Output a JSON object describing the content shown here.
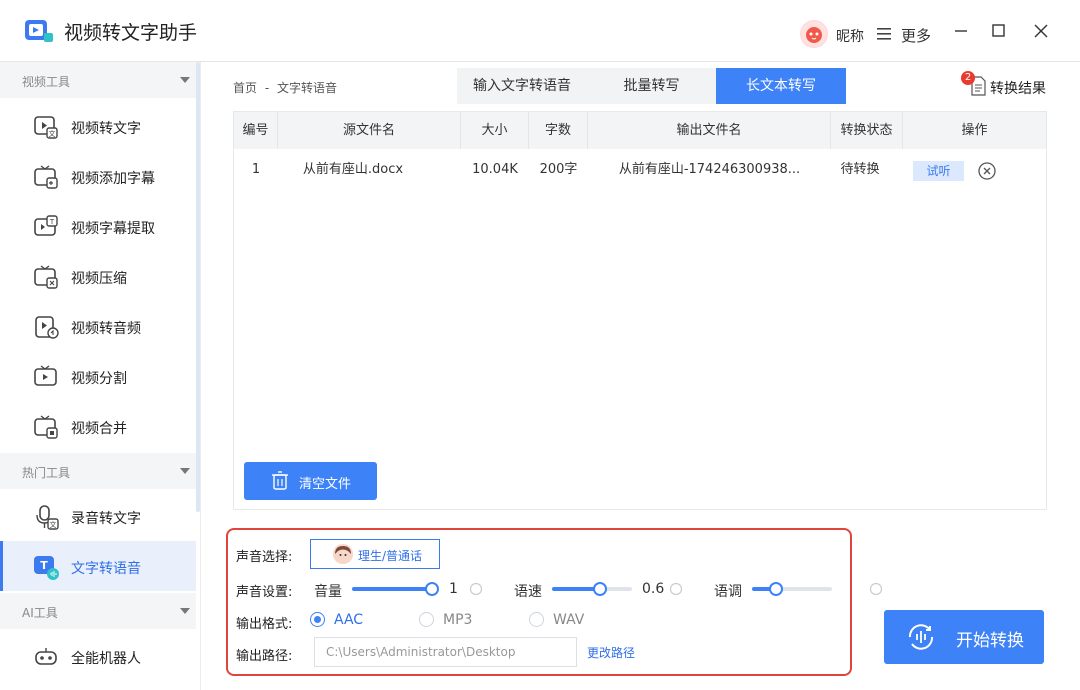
{
  "app": {
    "title": "视频转文字助手"
  },
  "topbar": {
    "nickname": "昵称",
    "more": "更多"
  },
  "sidebar": {
    "groups": [
      {
        "label": "视频工具",
        "items": [
          "视频转文字",
          "视频添加字幕",
          "视频字幕提取",
          "视频压缩",
          "视频转音频",
          "视频分割",
          "视频合并"
        ]
      },
      {
        "label": "热门工具",
        "items": [
          "录音转文字",
          "文字转语音"
        ]
      },
      {
        "label": "AI工具",
        "items": [
          "全能机器人"
        ]
      }
    ],
    "active_item": "文字转语音"
  },
  "breadcrumb": {
    "home": "首页",
    "sep": "-",
    "current": "文字转语音"
  },
  "tabs": [
    "输入文字转语音",
    "批量转写",
    "长文本转写"
  ],
  "active_tab": "长文本转写",
  "result": {
    "label": "转换结果",
    "badge": "2"
  },
  "table": {
    "headers": [
      "编号",
      "源文件名",
      "大小",
      "字数",
      "输出文件名",
      "转换状态",
      "操作"
    ],
    "rows": [
      {
        "no": "1",
        "source": "从前有座山.docx",
        "size": "10.04K",
        "words": "200字",
        "output": "从前有座山-174246300938...",
        "status": "待转换",
        "action": "试听"
      }
    ]
  },
  "clear_button": "清空文件",
  "settings": {
    "voice_label": "声音选择:",
    "voice_value": "理生/普通话",
    "sound_label": "声音设置:",
    "volume": {
      "label": "音量",
      "value": "1",
      "level": 1.0
    },
    "speed": {
      "label": "语速",
      "value": "0.6",
      "level": 0.6
    },
    "pitch": {
      "label": "语调",
      "value": "",
      "level": 0.3
    },
    "format_label": "输出格式:",
    "formats": [
      "AAC",
      "MP3",
      "WAV"
    ],
    "selected_format": "AAC",
    "path_label": "输出路径:",
    "path_value": "C:\\Users\\Administrator\\Desktop",
    "change_path": "更改路径"
  },
  "start_button": "开始转换",
  "colors": {
    "accent": "#3e82f7",
    "highlight_border": "#e0453a"
  }
}
